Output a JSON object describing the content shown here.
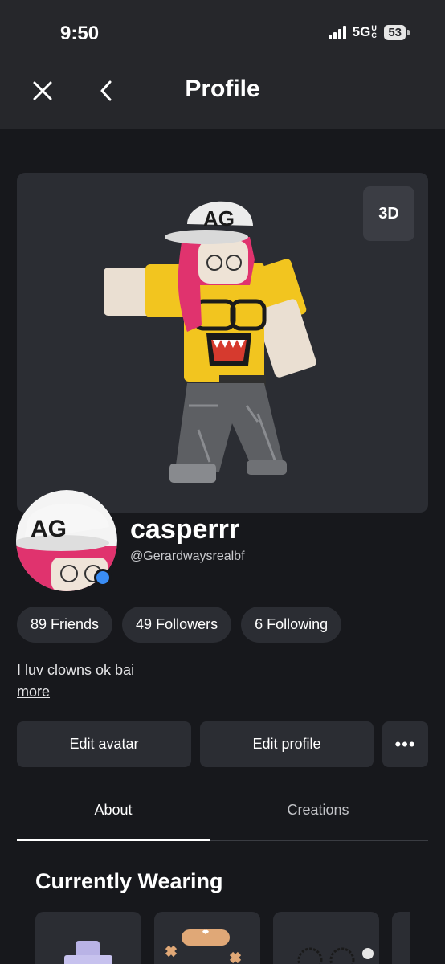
{
  "status_bar": {
    "time": "9:50",
    "network": "5G",
    "network_badge": "UC",
    "battery": "53"
  },
  "header": {
    "title": "Profile",
    "close_icon": "close-icon",
    "back_icon": "chevron-left-icon"
  },
  "viewport": {
    "toggle_label": "3D"
  },
  "profile": {
    "display_name": "casperrr",
    "username": "@Gerardwaysrealbf",
    "online_status_color": "#3a8df5",
    "bio": "I luv clowns ok bai",
    "bio_more": "more",
    "hat_text": "FAG"
  },
  "stats": {
    "friends": "89 Friends",
    "followers": "49 Followers",
    "following": "6 Following"
  },
  "actions": {
    "edit_avatar": "Edit avatar",
    "edit_profile": "Edit profile",
    "more": "•••"
  },
  "tabs": [
    {
      "label": "About",
      "active": true
    },
    {
      "label": "Creations",
      "active": false
    }
  ],
  "wearing": {
    "title": "Currently Wearing"
  },
  "colors": {
    "background": "#17181c",
    "surface": "#2b2d33",
    "header": "#26272b",
    "accent_shirt": "#f2c51f",
    "hair": "#e0336e"
  }
}
